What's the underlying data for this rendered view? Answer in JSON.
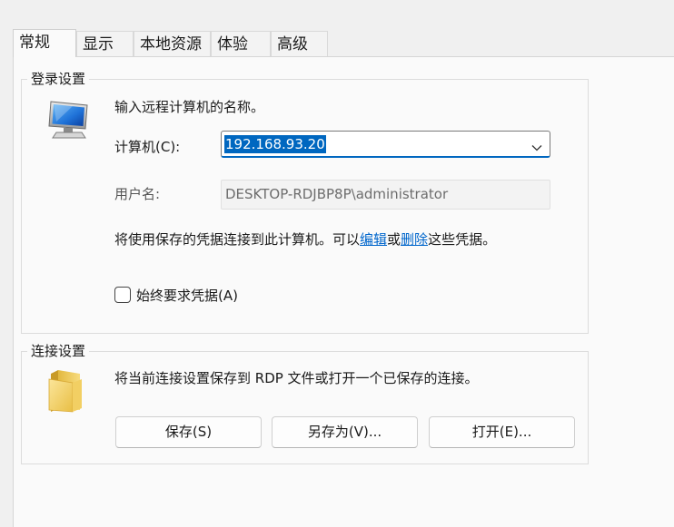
{
  "tabs": [
    {
      "label": "常规",
      "active": true
    },
    {
      "label": "显示",
      "active": false
    },
    {
      "label": "本地资源",
      "active": false
    },
    {
      "label": "体验",
      "active": false
    },
    {
      "label": "高级",
      "active": false
    }
  ],
  "login": {
    "group_title": "登录设置",
    "prompt": "输入远程计算机的名称。",
    "computer_label": "计算机(C):",
    "computer_value": "192.168.93.20",
    "username_label": "用户名:",
    "username_value": "DESKTOP-RDJBP8P\\administrator",
    "credentials_prefix": "将使用保存的凭据连接到此计算机。可以",
    "edit_link": "编辑",
    "or_text": "或",
    "delete_link": "删除",
    "credentials_suffix": "这些凭据。",
    "always_ask_label": "始终要求凭据(A)",
    "always_ask_checked": false,
    "icon": "computer-monitor-icon"
  },
  "connection": {
    "group_title": "连接设置",
    "description": "将当前连接设置保存到 RDP 文件或打开一个已保存的连接。",
    "save_button": "保存(S)",
    "save_as_button": "另存为(V)...",
    "open_button": "打开(E)...",
    "icon": "folder-icon"
  },
  "colors": {
    "accent": "#0067c0",
    "link": "#0066cc"
  }
}
